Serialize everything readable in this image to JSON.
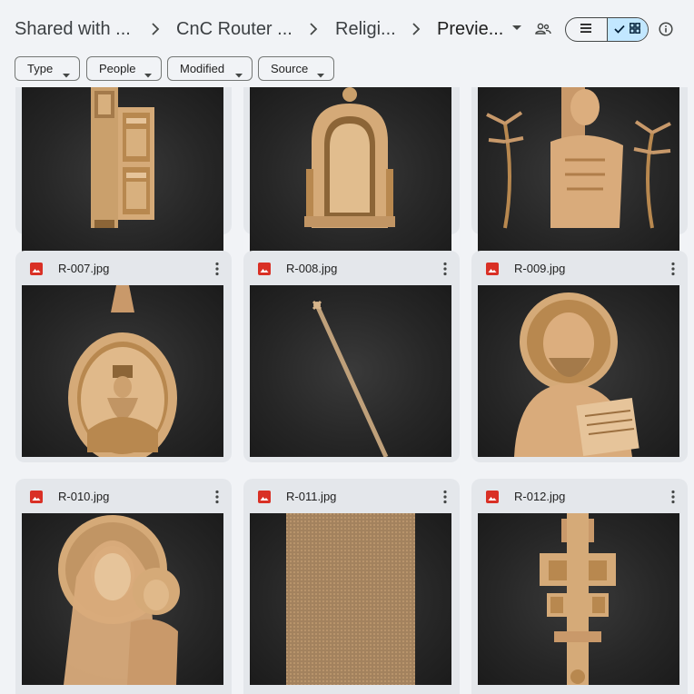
{
  "breadcrumb": {
    "items": [
      "Shared with ...",
      "CnC Router ...",
      "Religi...",
      "Previe..."
    ]
  },
  "filters": [
    "Type",
    "People",
    "Modified",
    "Source"
  ],
  "files": [
    {
      "name": ""
    },
    {
      "name": ""
    },
    {
      "name": ""
    },
    {
      "name": "R-007.jpg"
    },
    {
      "name": "R-008.jpg"
    },
    {
      "name": "R-009.jpg"
    },
    {
      "name": "R-010.jpg"
    },
    {
      "name": "R-011.jpg"
    },
    {
      "name": "R-012.jpg"
    }
  ],
  "colors": {
    "accent": "#c2e7ff",
    "image_icon": "#d93025",
    "wood": "#d9ae7c"
  },
  "icons": [
    "chevron-right-icon",
    "dropdown-arrow-icon",
    "people-icon",
    "list-view-icon",
    "check-icon",
    "grid-view-icon",
    "info-icon",
    "image-file-icon",
    "more-vert-icon"
  ]
}
